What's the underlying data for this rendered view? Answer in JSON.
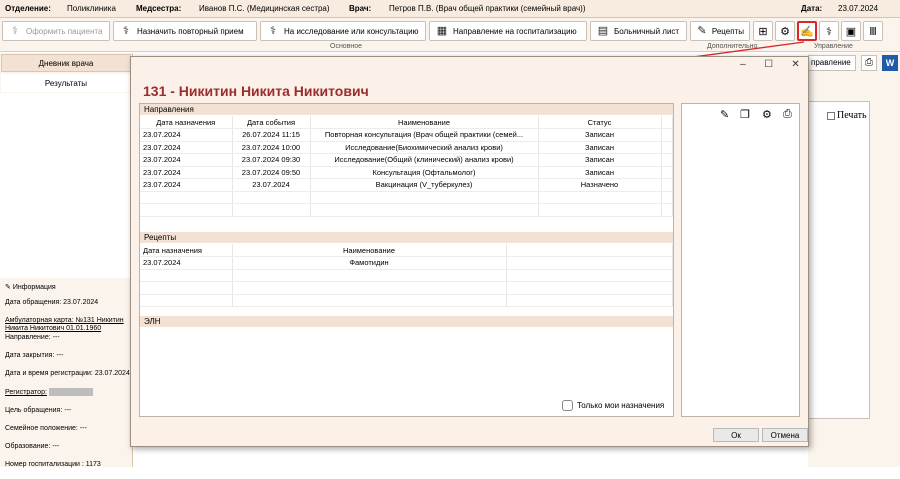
{
  "header": {
    "dept_label": "Отделение:",
    "dept_value": "Поликлиника",
    "nurse_label": "Медсестра:",
    "nurse_value": "Иванов П.С. (Медицинская сестра)",
    "doctor_label": "Врач:",
    "doctor_value": "Петров П.В. (Врач общей практики (семейный врач))",
    "date_label": "Дата:",
    "date_value": "23.07.2024"
  },
  "toolbar": {
    "register_patient": "Оформить пациента",
    "repeat_appointment": "Назначить повторный прием",
    "research": "На исследование или консультацию",
    "hospitalization": "Направление на госпитализацию",
    "sick_leave": "Больничный лист",
    "prescriptions": "Рецепты",
    "group_main": "Основное",
    "group_extra": "Дополнительно",
    "group_manage": "Управление"
  },
  "left_panel": {
    "tab_diary": "Дневник врача",
    "tab_results": "Результаты",
    "info_title": "Информация",
    "visit_date": "Дата обращения: 23.07.2024",
    "amb_card_1": "Амбулаторная карта: №131 Никитин",
    "amb_card_2": "Никита Никитович 01.01.1960",
    "direction": "Направление: ---",
    "close_date": "Дата закрытия: ---",
    "reg_datetime": "Дата и время регистрации: 23.07.2024",
    "registrar": "Регистратор:",
    "purpose": "Цель обращения: ---",
    "family": "Семейное положение: ---",
    "education": "Образование: ---",
    "hosp_number": "Номер госпитализации : 1173"
  },
  "background": {
    "direction_btn": "правление",
    "print_label": "Печать"
  },
  "dialog": {
    "title": "131 - Никитин Никита Никитович",
    "directions_section": "Направления",
    "directions_columns": [
      "Дата назначения",
      "Дата события",
      "Наименование",
      "Статус"
    ],
    "directions_rows": [
      [
        "23.07.2024",
        "26.07.2024 11:15",
        "Повторная консультация (Врач общей практики (семей...",
        "Записан"
      ],
      [
        "23.07.2024",
        "23.07.2024 10:00",
        "Исследование(Биохимический анализ крови)",
        "Записан"
      ],
      [
        "23.07.2024",
        "23.07.2024 09:30",
        "Исследование(Общий (клинический) анализ крови)",
        "Записан"
      ],
      [
        "23.07.2024",
        "23.07.2024 09:50",
        "Консультация (Офтальмолог)",
        "Записан"
      ],
      [
        "23.07.2024",
        "23.07.2024",
        "Вакцинация (V_туберкулез)",
        "Назначено"
      ]
    ],
    "recipes_section": "Рецепты",
    "recipes_columns": [
      "Дата назначения",
      "Наименование"
    ],
    "recipes_rows": [
      [
        "23.07.2024",
        "Фамотидин"
      ]
    ],
    "eln_section": "ЭЛН",
    "only_mine": "Только мои назначения",
    "ok": "Ок",
    "cancel": "Отмена"
  }
}
